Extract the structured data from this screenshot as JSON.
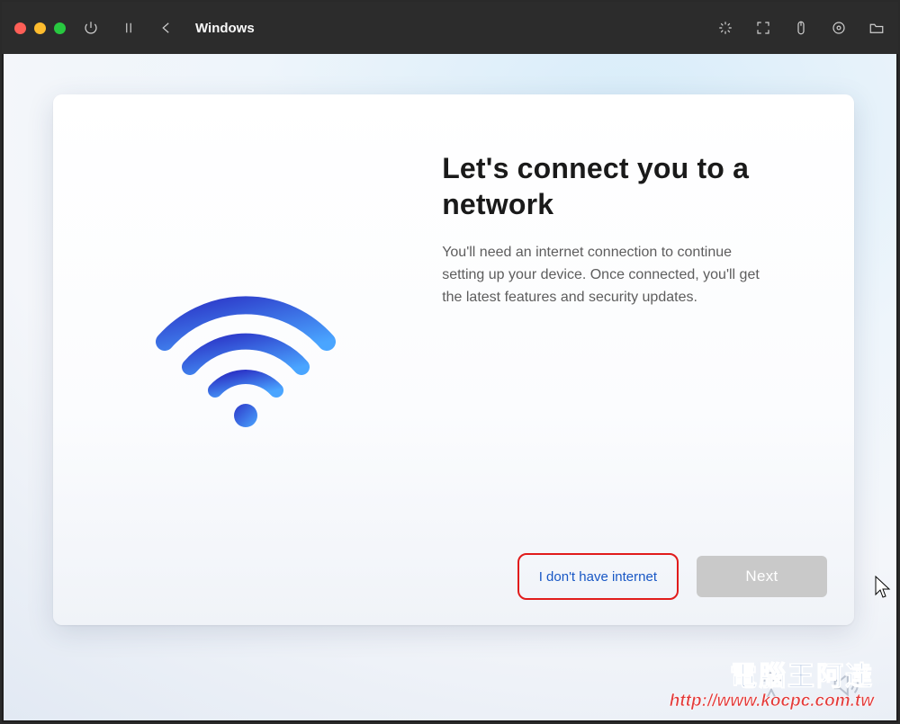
{
  "titlebar": {
    "app_label": "Windows"
  },
  "setup": {
    "heading": "Let's connect you to a network",
    "description": "You'll need an internet connection to continue setting up your device. Once connected, you'll get the latest features and security updates.",
    "no_internet_label": "I don't have internet",
    "next_label": "Next"
  },
  "watermark": {
    "site_name_zh": "電腦王阿達",
    "site_url": "http://www.kocpc.com.tw"
  },
  "colors": {
    "wifi_gradient_start": "#2c37c8",
    "wifi_gradient_end": "#4aa5ff",
    "highlight": "#e11b1b",
    "link": "#1857c5"
  }
}
